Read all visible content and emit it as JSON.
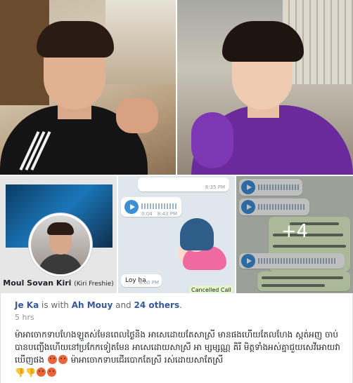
{
  "photos": [
    {
      "label": "photo-man-black-jacket"
    },
    {
      "label": "photo-man-purple-shirt"
    },
    {
      "label": "photo-profile-screenshot"
    },
    {
      "label": "photo-chat-screenshot-1"
    },
    {
      "label": "photo-chat-screenshot-2"
    }
  ],
  "profile_card": {
    "name": "Moul Sovan Kiri",
    "nickname": "(Kiri Freshie)"
  },
  "chat1": {
    "time_top": "8:35 PM",
    "audio_duration": "0:04",
    "audio_time": "8:43 PM",
    "message": "Loy ha",
    "message_time": "8:00 PM",
    "bottom_text": "Cancelled Call"
  },
  "chat2": {
    "more_count": "+4"
  },
  "post": {
    "author": "Je Ka",
    "with_text": "is with",
    "tagged": "Ah Mouy",
    "and_text": "and",
    "others": "24 others",
    "period": ".",
    "time": "5 hrs",
    "text_part1": "ម៉ាអាចោកទាបហែងឡួតស់មែនពេលថ្ងៃនិង អាសេដោយតែសាស្រី មានផងហើយតែលហែង ស្កត់អញ ចាប់បានបញ្ចើងហើយនៅប្រកែកទៀតមែន អាសេដោយសាស្រី អា ម្សម្សណ្ណ គិរី មិត្តទាំងអស់គ្នាជួយសេវីអោយវាឃើញផង",
    "text_part2": "ម៉ាអាចោកទាបជើរបោកតែស្រី រស់ដោយសាតែស្រី"
  }
}
